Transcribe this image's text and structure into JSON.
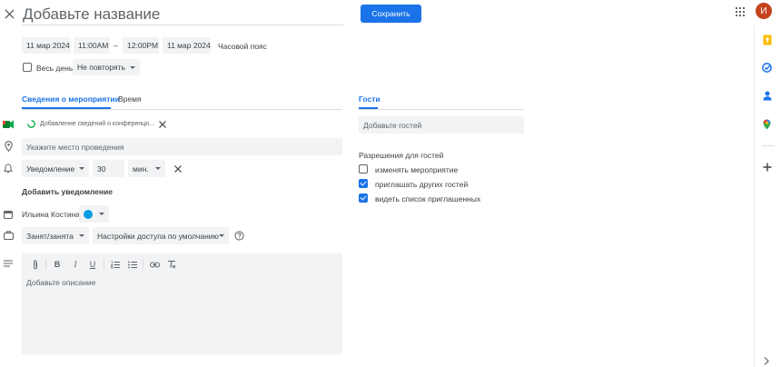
{
  "header": {
    "title_placeholder": "Добавьте название",
    "save_label": "Сохранить",
    "avatar_letter": "И"
  },
  "datetime": {
    "start_date": "11 мар 2024",
    "start_time": "11:00AM",
    "dash": "–",
    "end_time": "12:00PM",
    "end_date": "11 мар 2024",
    "timezone": "Часовой пояс",
    "all_day": "Весь день",
    "repeat": "Не повторять"
  },
  "tabs": {
    "details": "Сведения о мероприятии",
    "time": "Время",
    "guests": "Гости"
  },
  "details": {
    "conference": "Добавление сведений о конференци...",
    "location_placeholder": "Укажите место проведения",
    "notification_type": "Уведомление",
    "notification_value": "30",
    "notification_unit": "мин.",
    "add_notification": "Добавить уведомление",
    "calendar_owner": "Ильина Костина",
    "calendar_color": "#039be5",
    "busy": "Занят/занята",
    "visibility": "Настройки доступа по умолчанию",
    "description_placeholder": "Добавьте описание"
  },
  "guests": {
    "add_placeholder": "Добавьте гостей",
    "permissions_title": "Разрешения для гостей",
    "permissions": [
      {
        "label": "изменять мероприятие",
        "checked": false
      },
      {
        "label": "приглашать других гостей",
        "checked": true
      },
      {
        "label": "видеть список приглашенных",
        "checked": true
      }
    ]
  },
  "colors": {
    "accent": "#1a73e8",
    "avatar": "#c5421c",
    "field_bg": "#f1f3f4"
  }
}
